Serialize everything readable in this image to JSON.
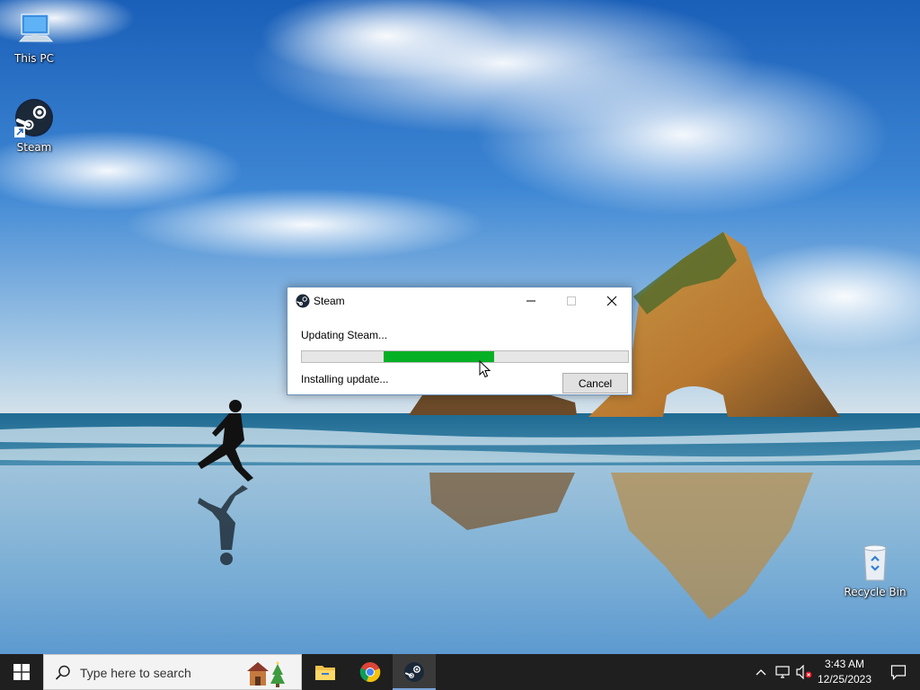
{
  "desktop": {
    "icons": [
      {
        "label": "This PC",
        "icon": "this-pc-icon"
      },
      {
        "label": "Steam",
        "icon": "steam-icon"
      },
      {
        "label": "Recycle Bin",
        "icon": "recycle-bin-icon"
      }
    ]
  },
  "dialog": {
    "title": "Steam",
    "status": "Updating Steam...",
    "detail": "Installing update...",
    "cancel_label": "Cancel",
    "progress": {
      "start_fraction": 0.25,
      "end_fraction": 0.59
    },
    "colors": {
      "progress_fill": "#06b025"
    }
  },
  "taskbar": {
    "search_placeholder": "Type here to search",
    "apps": [
      "file-explorer-icon",
      "chrome-icon",
      "steam-icon"
    ],
    "active_app": "steam-icon",
    "clock": {
      "time": "3:43 AM",
      "date": "12/25/2023"
    }
  }
}
